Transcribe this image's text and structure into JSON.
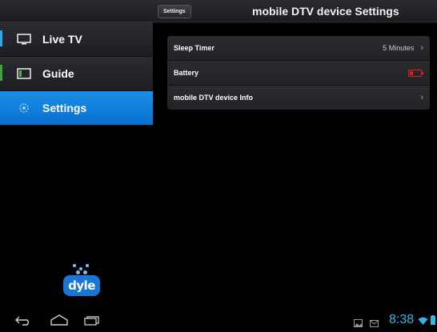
{
  "header": {
    "back_label": "Settings",
    "title": "mobile DTV device Settings"
  },
  "sidebar": {
    "items": [
      {
        "label": "Live TV",
        "icon": "tv-icon",
        "active": false
      },
      {
        "label": "Guide",
        "icon": "guide-icon",
        "active": false
      },
      {
        "label": "Settings",
        "icon": "settings-icon",
        "active": true
      }
    ],
    "logo_text": "dyle"
  },
  "settings": {
    "rows": [
      {
        "label": "Sleep Timer",
        "value": "5 Minutes"
      },
      {
        "label": "Battery",
        "value": ""
      },
      {
        "label": "mobile DTV device Info",
        "value": ""
      }
    ]
  },
  "system_bar": {
    "time": "8:38"
  },
  "colors": {
    "accent": "#1a8fe8",
    "clock": "#33b5e5",
    "battery": "#e02020"
  }
}
